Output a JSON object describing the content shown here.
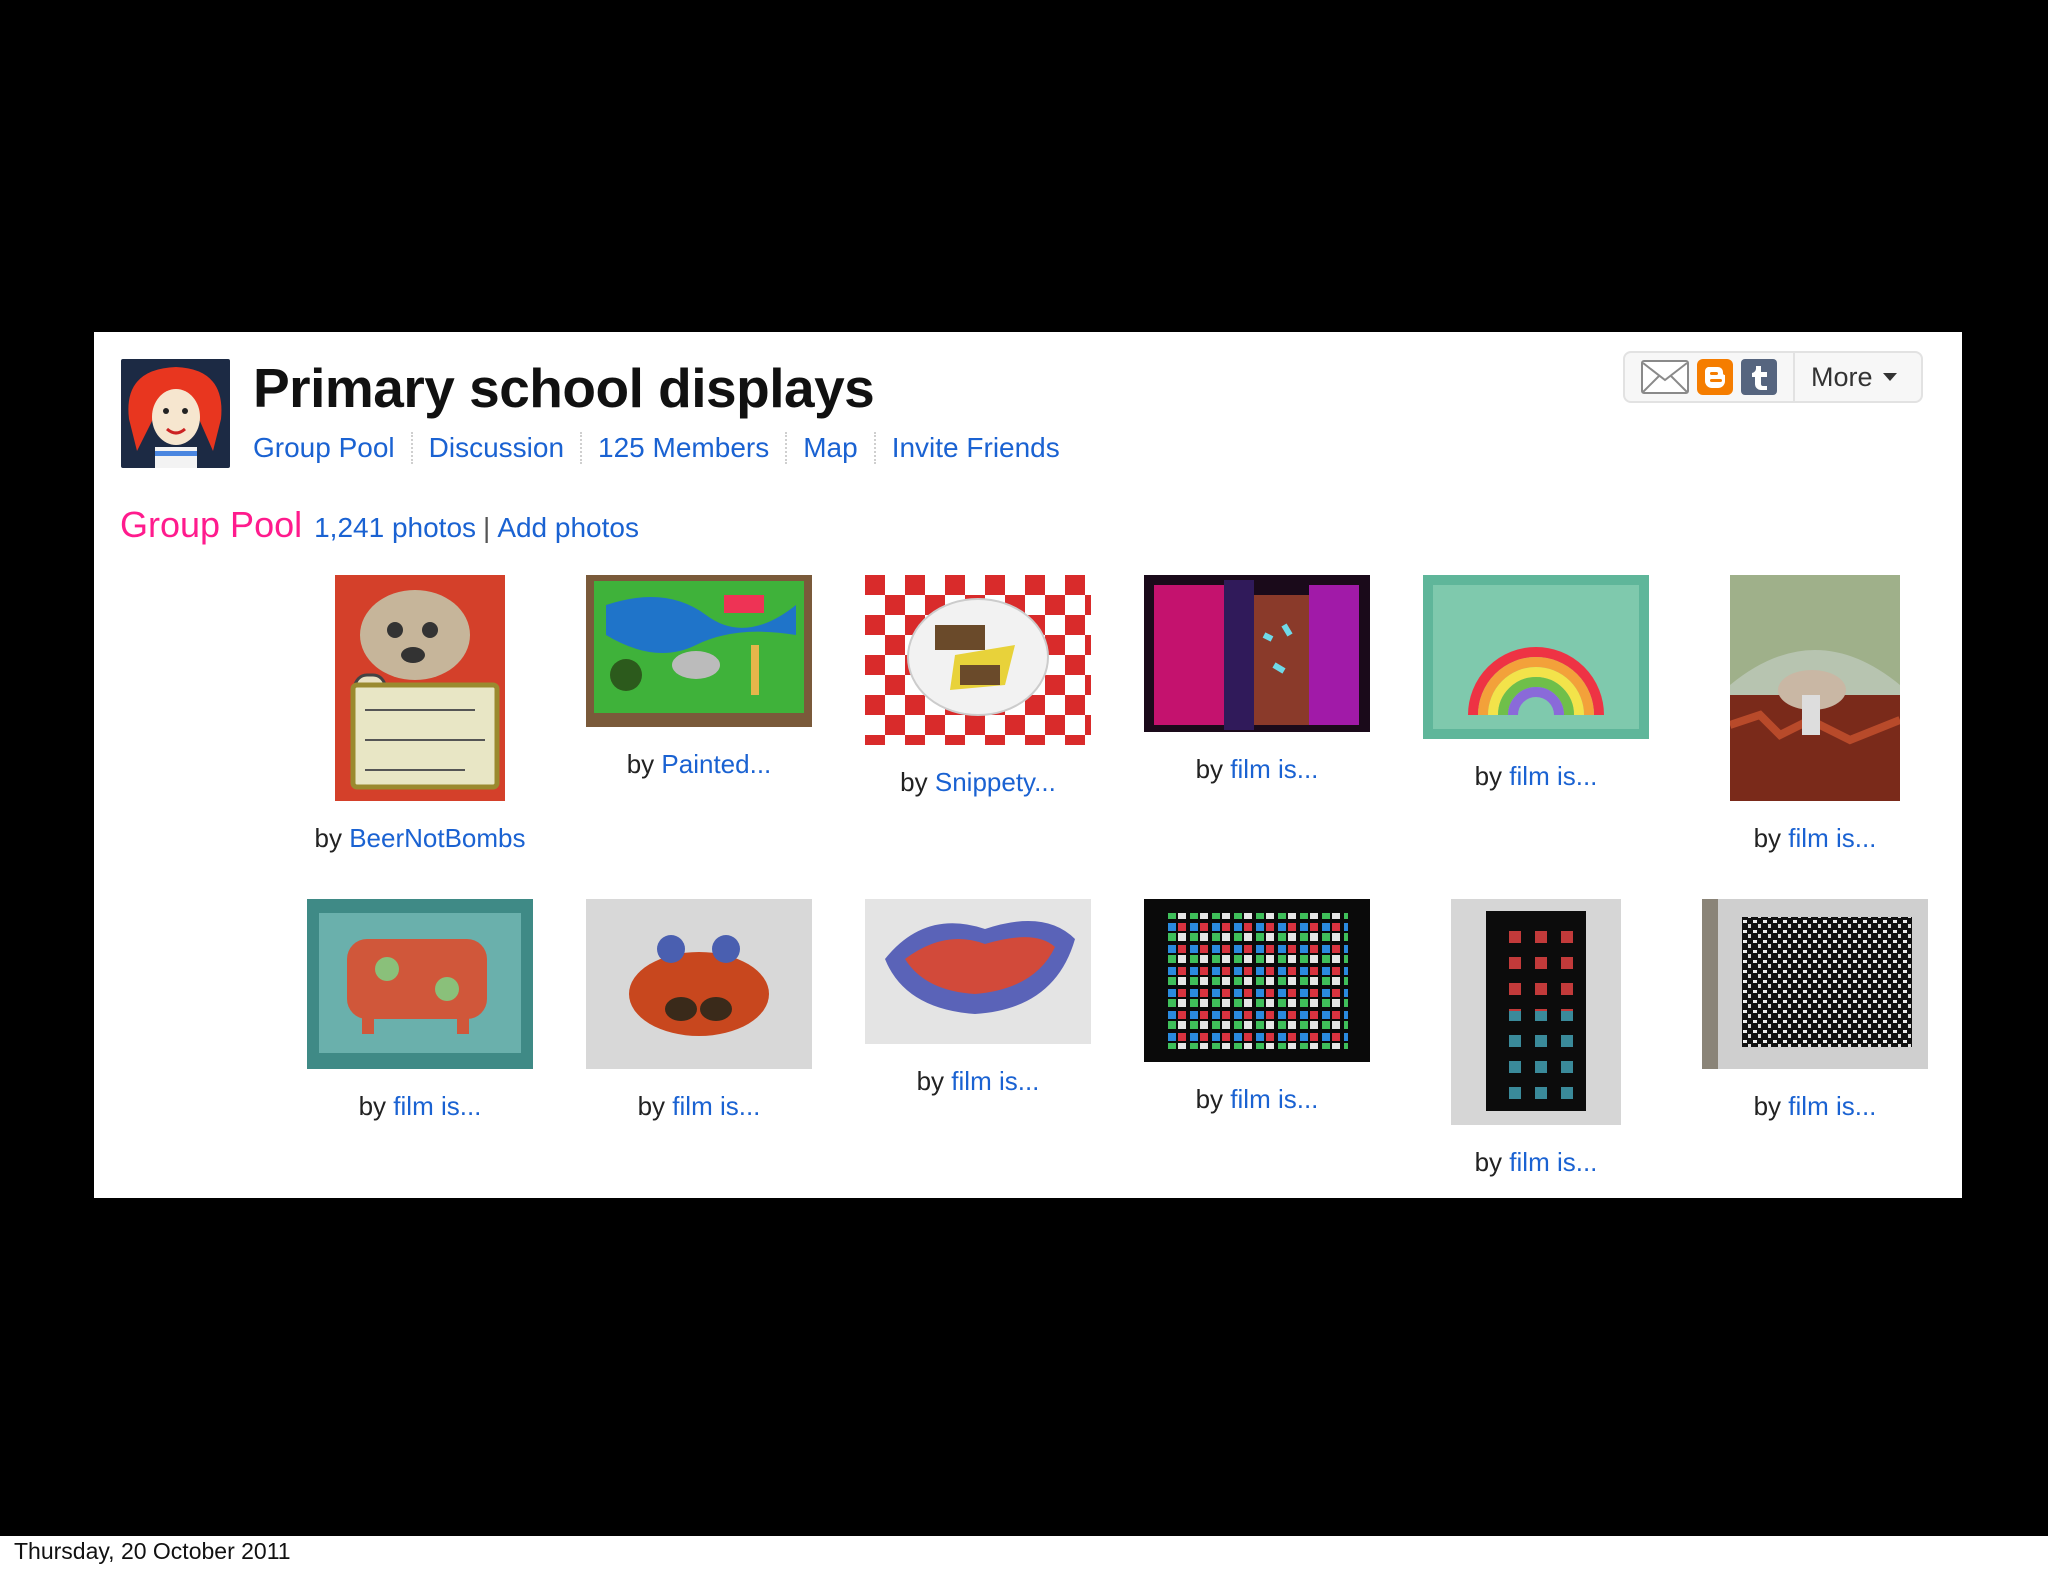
{
  "group": {
    "title": "Primary school displays",
    "nav": [
      {
        "label": "Group Pool"
      },
      {
        "label": "Discussion"
      },
      {
        "label": "125 Members"
      },
      {
        "label": "Map"
      },
      {
        "label": "Invite Friends"
      }
    ]
  },
  "share": {
    "icons": [
      "email-icon",
      "blogger-icon",
      "tumblr-icon"
    ],
    "more_label": "More",
    "colors": {
      "blogger": "#f57d00",
      "tumblr": "#35465c"
    }
  },
  "pool": {
    "title": "Group Pool",
    "photo_count": "1,241 photos",
    "separator": "|",
    "add_label": "Add photos"
  },
  "photos": [
    {
      "by": "by",
      "author": "BeerNotBombs",
      "icon": "dog-poster-thumbnail"
    },
    {
      "by": "by",
      "author": "Painted...",
      "icon": "jungle-display-thumbnail"
    },
    {
      "by": "by",
      "author": "Snippety...",
      "icon": "checkered-plate-thumbnail"
    },
    {
      "by": "by",
      "author": "film is...",
      "icon": "pink-abstract-thumbnail"
    },
    {
      "by": "by",
      "author": "film is...",
      "icon": "rainbow-painting-thumbnail"
    },
    {
      "by": "by",
      "author": "film is...",
      "icon": "mushroom-sculpture-thumbnail"
    },
    {
      "by": "by",
      "author": "film is...",
      "icon": "clay-cow-tile-thumbnail"
    },
    {
      "by": "by",
      "author": "film is...",
      "icon": "clay-crab-thumbnail"
    },
    {
      "by": "by",
      "author": "film is...",
      "icon": "clay-bowl-thumbnail"
    },
    {
      "by": "by",
      "author": "film is...",
      "icon": "mosaic-tiles-thumbnail"
    },
    {
      "by": "by",
      "author": "film is...",
      "icon": "tile-panel-thumbnail"
    },
    {
      "by": "by",
      "author": "film is...",
      "icon": "black-white-weave-thumbnail"
    }
  ],
  "footer": {
    "date": "Thursday, 20 October 2011"
  },
  "colors": {
    "link": "#1a62d2",
    "pool_title": "#ff1b8d",
    "slide_bg": "#000000"
  }
}
